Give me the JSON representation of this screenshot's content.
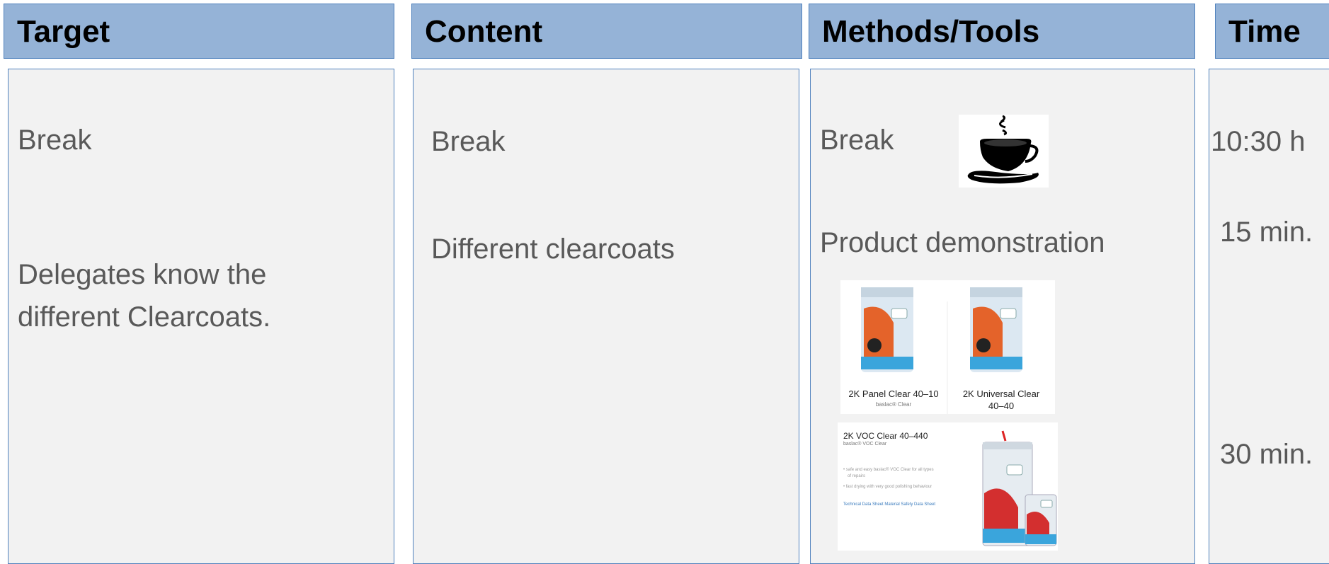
{
  "headers": {
    "target": "Target",
    "content": "Content",
    "methods": "Methods/Tools",
    "time": "Time"
  },
  "target": {
    "row1": "Break",
    "row2_line1": "Delegates know the",
    "row2_line2": "different Clearcoats."
  },
  "content": {
    "row1": "Break",
    "row2": "Different clearcoats"
  },
  "methods": {
    "row1": "Break",
    "row2": "Product demonstration",
    "products": [
      {
        "name": "2K Panel Clear 40–10",
        "sub": "baslac® Clear"
      },
      {
        "name": "2K Universal Clear",
        "name2": "40–40"
      }
    ],
    "voc": {
      "title": "2K VOC Clear 40–440",
      "sub": "baslac® VOC Clear",
      "bullet1": "• safe and easy baslac® VOC Clear for all types",
      "bullet1b": "of repairs",
      "bullet2": "• fast drying with very good polishing behaviour",
      "links": "Technical Data Sheet   Material Safety Data Sheet"
    }
  },
  "time": {
    "row1": "10:30 h",
    "row2": "15 min.",
    "row3": "30 min."
  },
  "icons": [
    "coffee-cup-icon"
  ],
  "colors": {
    "header_bg": "#95b3d7",
    "border": "#4f81bd",
    "cell_bg": "#f2f2f2",
    "text": "#595959"
  }
}
